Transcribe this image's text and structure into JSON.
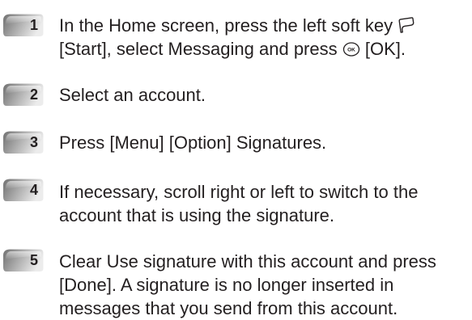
{
  "steps": [
    {
      "number": "1",
      "lines": [
        [
          "In the Home screen, press the left soft key",
          "[Start], select Messaging and press",
          "[OK]."
        ]
      ]
    },
    {
      "number": "2",
      "text": "Select an account."
    },
    {
      "number": "3",
      "text": "Press [Menu] [Option] Signatures."
    },
    {
      "number": "4",
      "lines": [
        "If necessary, scroll right or left to switch to the",
        "account that is using the signature."
      ]
    },
    {
      "number": "5",
      "lines": [
        "Clear Use signature with this account and press",
        "[Done]. A signature is no longer inserted in",
        "messages that you send from this account."
      ]
    }
  ],
  "step1": {
    "line1": "In the Home screen, press the left soft key",
    "line2a": "[Start], select Messaging and press",
    "line2b": "[OK]."
  },
  "icons": {
    "soft_key": "left-soft-key-icon",
    "ok_key": "ok-key-icon"
  },
  "colors": {
    "badge_dark": "#8c8c8c",
    "badge_light": "#e6e6e6",
    "text": "#231f20"
  }
}
